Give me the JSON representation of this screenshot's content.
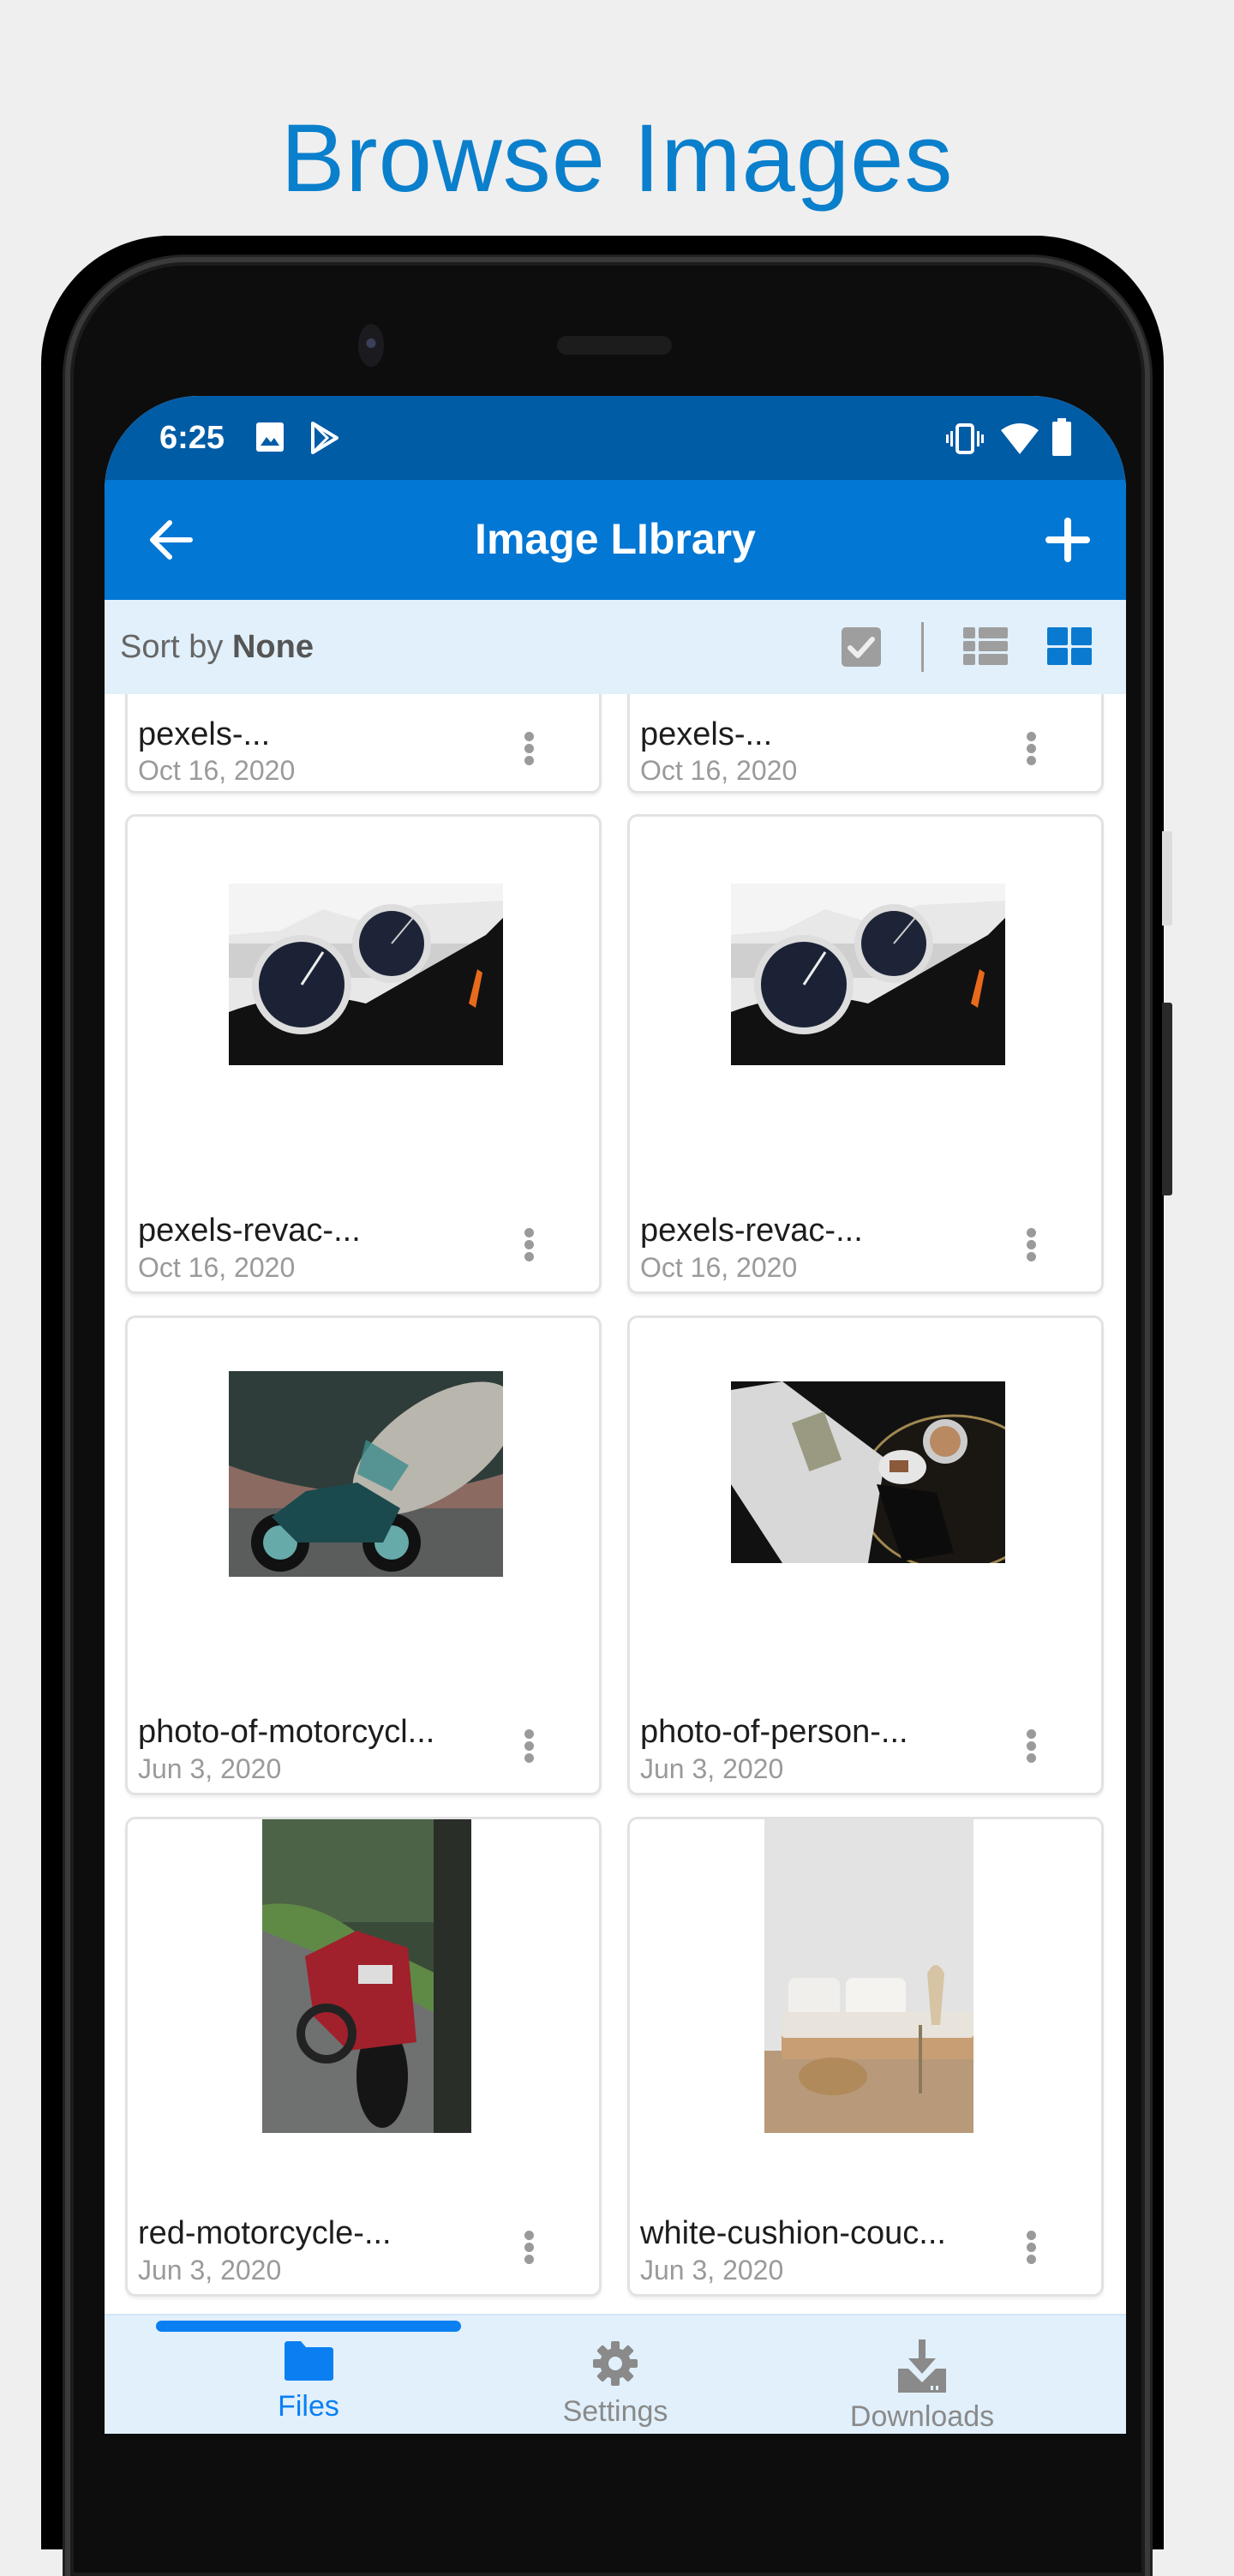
{
  "promo": {
    "title": "Browse Images"
  },
  "status_bar": {
    "time": "6:25",
    "left_icons": [
      "image-notification-icon",
      "play-store-icon"
    ],
    "right_icons": [
      "vibrate-icon",
      "wifi-icon",
      "battery-icon"
    ]
  },
  "app_bar": {
    "title": "Image LIbrary",
    "back_icon": "arrow-left-icon",
    "add_icon": "plus-icon"
  },
  "sort_bar": {
    "prefix": "Sort by",
    "value": "None",
    "tools": [
      {
        "name": "select-all",
        "icon": "checkbox-icon",
        "active": false
      },
      {
        "name": "list-view",
        "icon": "list-view-icon",
        "active": false
      },
      {
        "name": "grid-view",
        "icon": "grid-view-icon",
        "active": true
      }
    ]
  },
  "grid": {
    "items": [
      {
        "name": "pexels-...",
        "date": "Oct 16, 2020",
        "thumb": "partial"
      },
      {
        "name": "pexels-...",
        "date": "Oct 16, 2020",
        "thumb": "partial"
      },
      {
        "name": "pexels-revac-...",
        "date": "Oct 16, 2020",
        "thumb": "motorcycle-gauges"
      },
      {
        "name": "pexels-revac-...",
        "date": "Oct 16, 2020",
        "thumb": "motorcycle-gauges"
      },
      {
        "name": "photo-of-motorcycl...",
        "date": "Jun 3, 2020",
        "thumb": "motorcycle-airplane"
      },
      {
        "name": "photo-of-person-...",
        "date": "Jun 3, 2020",
        "thumb": "newspaper-coffee"
      },
      {
        "name": "red-motorcycle-...",
        "date": "Jun 3, 2020",
        "thumb": "red-motorcycle"
      },
      {
        "name": "white-cushion-couc...",
        "date": "Jun 3, 2020",
        "thumb": "white-couch"
      }
    ]
  },
  "bottom_nav": {
    "items": [
      {
        "label": "Files",
        "icon": "folder-icon",
        "active": true
      },
      {
        "label": "Settings",
        "icon": "gear-icon",
        "active": false
      },
      {
        "label": "Downloads",
        "icon": "download-icon",
        "active": false
      }
    ]
  },
  "colors": {
    "accent": "#0277d3",
    "status_bar": "#015ca6",
    "promo_title": "#0a7fcc",
    "toolbar_bg": "#e1f0fb",
    "nav_active": "#0a7ff2",
    "inactive_icon": "#9a9a9a"
  }
}
